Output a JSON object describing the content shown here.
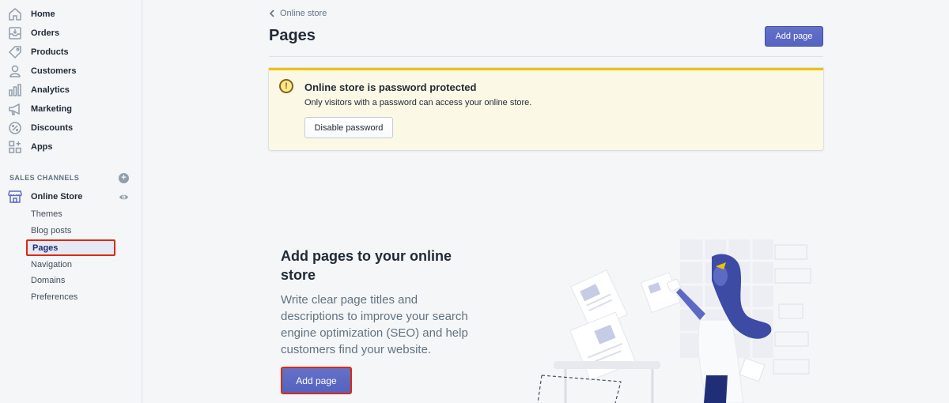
{
  "sidebar": {
    "items": [
      {
        "label": "Home",
        "icon": "home-icon"
      },
      {
        "label": "Orders",
        "icon": "orders-icon"
      },
      {
        "label": "Products",
        "icon": "tag-icon"
      },
      {
        "label": "Customers",
        "icon": "person-icon"
      },
      {
        "label": "Analytics",
        "icon": "bar-chart-icon"
      },
      {
        "label": "Marketing",
        "icon": "megaphone-icon"
      },
      {
        "label": "Discounts",
        "icon": "discount-icon"
      },
      {
        "label": "Apps",
        "icon": "apps-icon"
      }
    ],
    "sales_channels_title": "SALES CHANNELS",
    "channel": {
      "label": "Online Store",
      "icon": "store-icon"
    },
    "sub_items": [
      "Themes",
      "Blog posts",
      "Pages",
      "Navigation",
      "Domains",
      "Preferences"
    ]
  },
  "main": {
    "breadcrumb": "Online store",
    "title": "Pages",
    "add_page_label": "Add page",
    "banner": {
      "title": "Online store is password protected",
      "text": "Only visitors with a password can access your online store.",
      "button_label": "Disable password"
    },
    "empty_state": {
      "title": "Add pages to your online store",
      "description": "Write clear page titles and descriptions to improve your search engine optimization (SEO) and help customers find your website.",
      "button_label": "Add page"
    }
  },
  "colors": {
    "primary": "#5c6ac4",
    "warning": "#eec200",
    "highlight_border": "#d82c0d",
    "illustration_accent": "#202e78"
  }
}
